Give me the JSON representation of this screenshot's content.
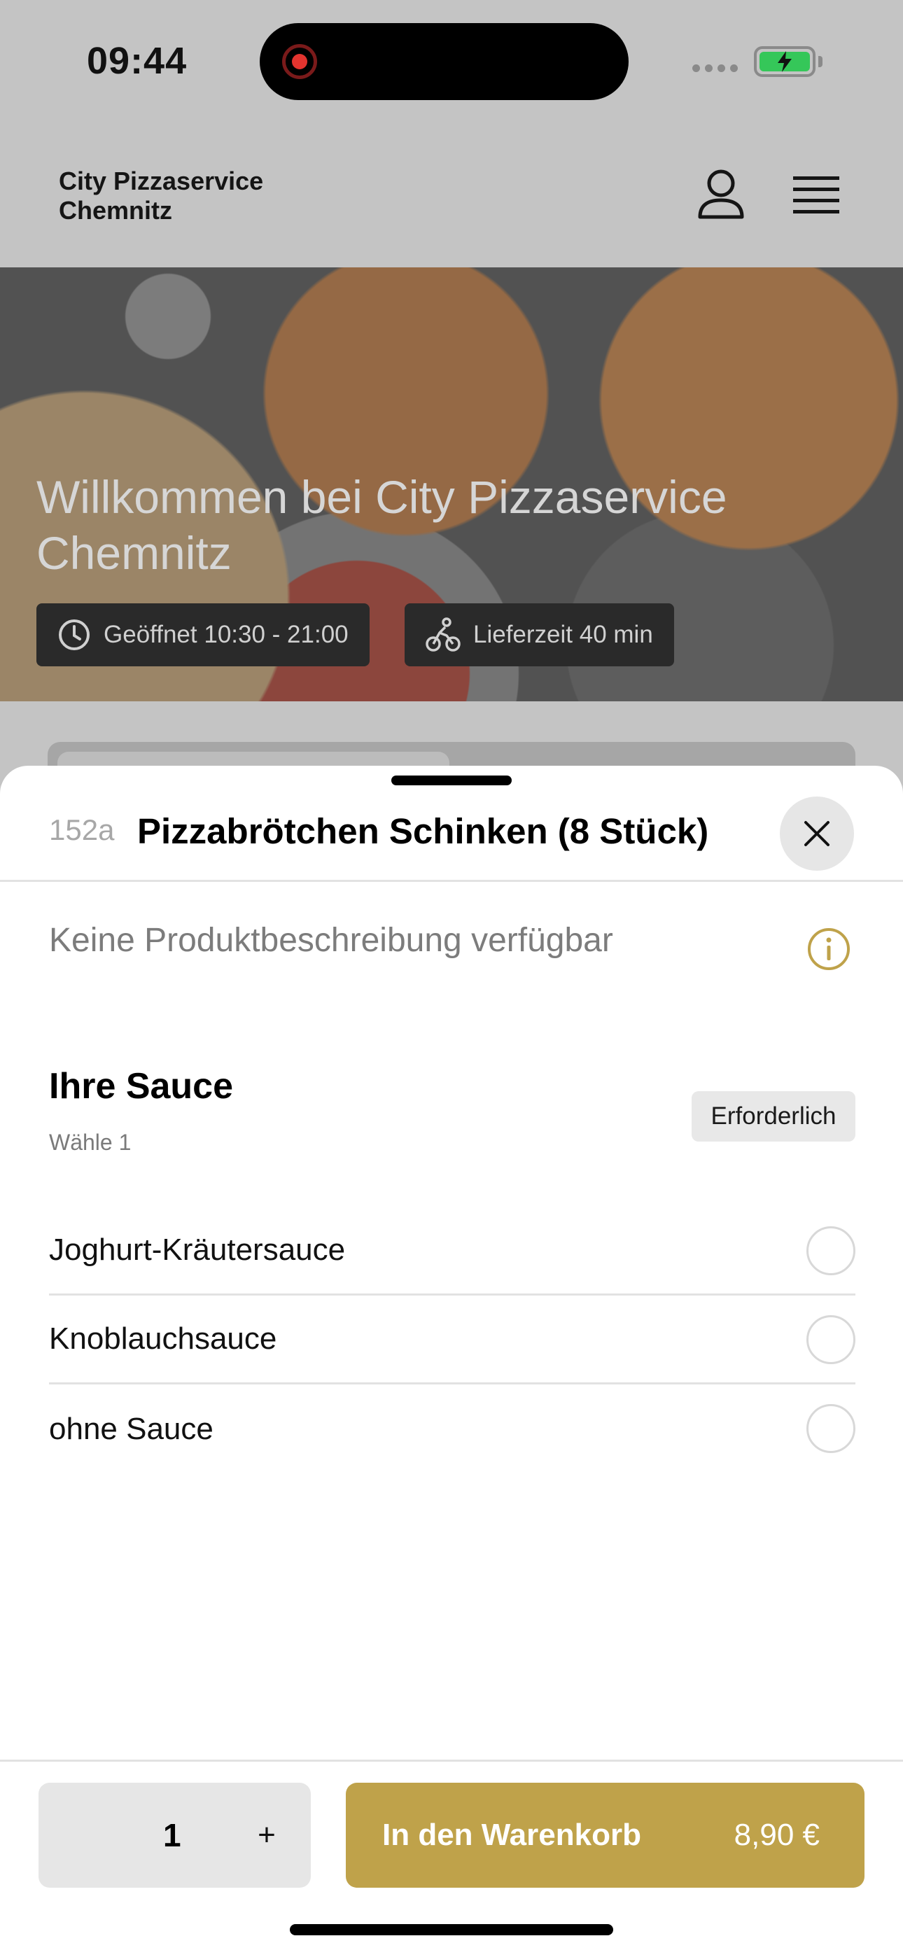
{
  "status_bar": {
    "time": "09:44",
    "battery_color": "#35c759",
    "recording_color": "#e3342f"
  },
  "header": {
    "brand": "City Pizzaservice Chemnitz",
    "account_icon": "person-icon",
    "menu_icon": "hamburger-menu-icon"
  },
  "hero": {
    "title": "Willkommen bei City Pizzaservice Chemnitz",
    "open_hours": "Geöffnet 10:30 - 21:00",
    "delivery_time": "Lieferzeit 40 min"
  },
  "product_sheet": {
    "item_number": "152a",
    "title": "Pizzabrötchen Schinken (8 Stück)",
    "description": "Keine Produktbeschreibung verfügbar",
    "option_group": {
      "title": "Ihre Sauce",
      "subtitle": "Wähle 1",
      "required_label": "Erforderlich",
      "options": [
        {
          "label": "Joghurt-Kräutersauce",
          "selected": false
        },
        {
          "label": "Knoblauchsauce",
          "selected": false
        },
        {
          "label": "ohne Sauce",
          "selected": false
        }
      ]
    },
    "footer": {
      "quantity": "1",
      "plus_label": "+",
      "add_to_cart_label": "In den Warenkorb",
      "price": "8,90 €",
      "accent_color": "#bfa24a"
    }
  }
}
